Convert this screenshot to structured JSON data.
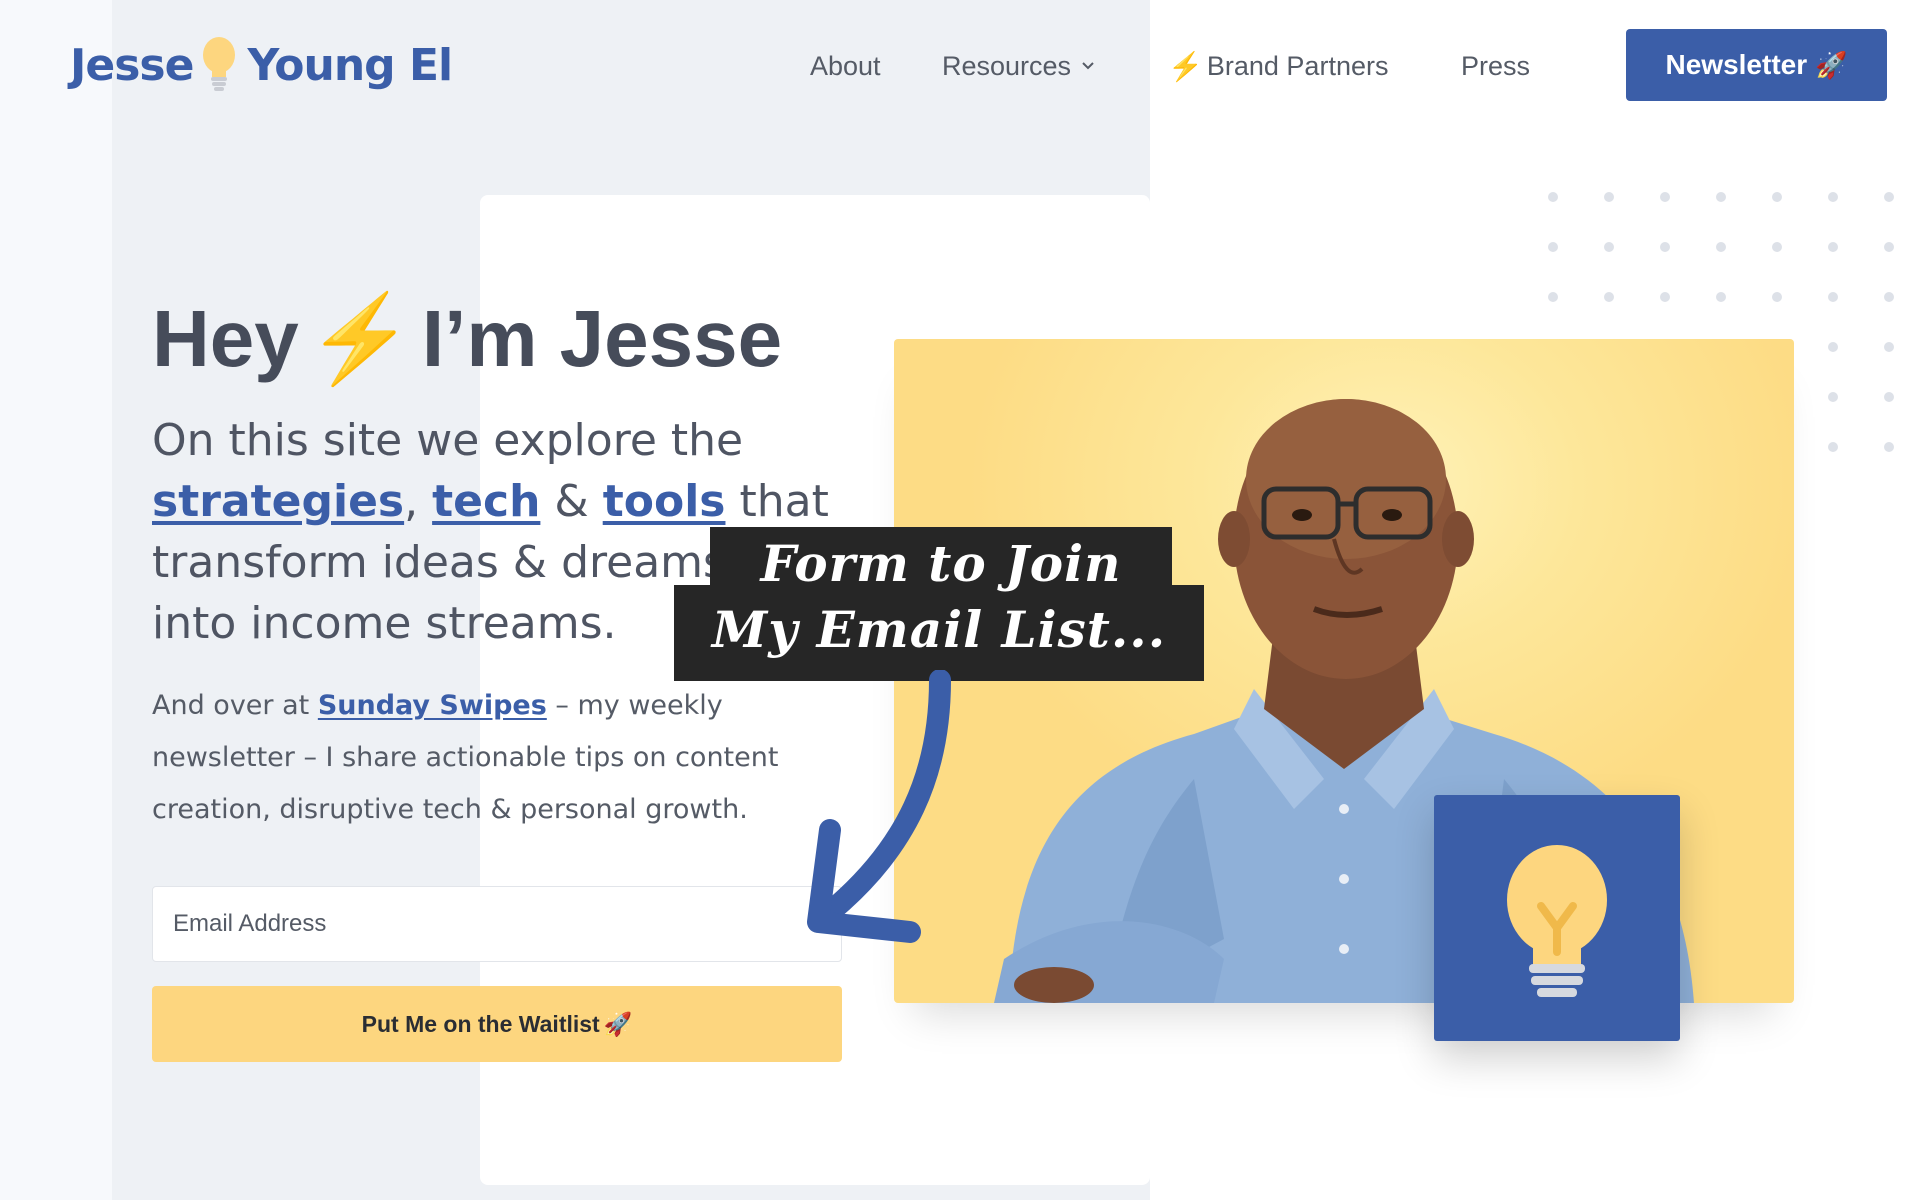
{
  "header": {
    "logo_part1": "Jesse",
    "logo_part2": "Young El",
    "nav": {
      "about": "About",
      "resources": "Resources",
      "brand_partners": "Brand Partners",
      "press": "Press"
    },
    "newsletter_label": "Newsletter",
    "rocket": "🚀",
    "bolt": "⚡"
  },
  "hero": {
    "title_part1": "Hey",
    "title_part2": "I’m Jesse",
    "sub_line1": "On this site we explore the",
    "link_strategies": "strategies",
    "comma": ",",
    "link_tech": "tech",
    "amp": "&",
    "link_tools": "tools",
    "that": "that",
    "sub_line3": "transform ideas & dreams",
    "sub_line4": "into income streams.",
    "body_pre": "And over at",
    "body_link": "Sunday Swipes",
    "body_post": "– my weekly newsletter – I share actionable tips on content creation, disruptive tech & personal growth."
  },
  "form": {
    "email_placeholder": "Email Address",
    "submit_label": "Put Me on the Waitlist"
  },
  "annotation": {
    "line1": "Form to Join",
    "line2": "My Email List..."
  },
  "colors": {
    "brand_blue": "#3b5ea8",
    "accent_yellow": "#fdd67f",
    "bolt_orange": "#f5a623"
  },
  "icons": {
    "logo_bulb": "lightbulb-icon",
    "nav_bolt": "lightning-bolt-icon",
    "resources_chevron": "chevron-down-icon",
    "newsletter": "rocket-icon",
    "card": "lightbulb-icon"
  }
}
